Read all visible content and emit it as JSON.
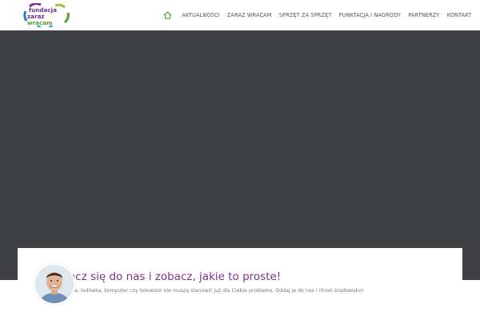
{
  "header": {
    "logo": {
      "line1": "fundacja",
      "line2a": "zaraz ",
      "line2b": "wracam"
    },
    "home_icon": "home-icon",
    "nav": [
      {
        "label": "AKTUALNOŚCI"
      },
      {
        "label": "ZARAZ WRACAM"
      },
      {
        "label": "SPRZĘT ZA SPRZĘT"
      },
      {
        "label": "PUNKTACJA I NAGRODY"
      },
      {
        "label": "PARTNERZY"
      },
      {
        "label": "KONTAKT"
      }
    ]
  },
  "card": {
    "title": "ącz się do nas i zobacz, jakie to proste!",
    "text": "lka, lodówka, komputer czy telewizor nie muszą stanowić już dla Ciebie problemu. Oddaj je do nas i chroń środowisko!"
  },
  "colors": {
    "accent_purple": "#7d2f92",
    "accent_green": "#5aa02c",
    "hero_bg": "#3f4043"
  }
}
